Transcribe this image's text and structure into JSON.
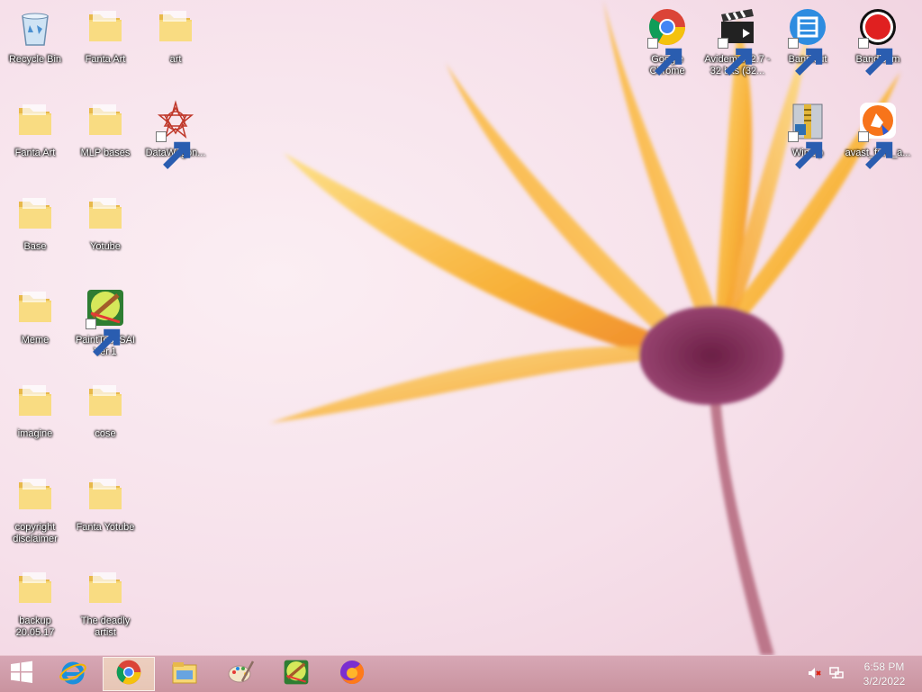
{
  "desktop": {
    "icons": [
      {
        "name": "recycle-bin",
        "label": "Recycle Bin",
        "icon": "recycle-bin-icon"
      },
      {
        "name": "folder-fanta-art-1",
        "label": "Fanta Art",
        "icon": "folder-icon"
      },
      {
        "name": "folder-art",
        "label": "art",
        "icon": "folder-icon"
      },
      {
        "name": "folder-fanta-art-2",
        "label": "Fanta Art",
        "icon": "folder-icon"
      },
      {
        "name": "folder-mlp-bases",
        "label": "MLP bases",
        "icon": "folder-icon"
      },
      {
        "name": "datawagon-shortcut",
        "label": "DataWagon...",
        "icon": "datawagon-icon"
      },
      {
        "name": "folder-base",
        "label": "Base",
        "icon": "folder-icon"
      },
      {
        "name": "folder-yotube",
        "label": "Yotube",
        "icon": "folder-icon"
      },
      {
        "name": "folder-meme",
        "label": "Meme",
        "icon": "folder-icon"
      },
      {
        "name": "painttool-sai-shortcut",
        "label": "PaintTool SAI Ver.1",
        "icon": "painttool-sai-icon"
      },
      {
        "name": "folder-imagine",
        "label": "imagine",
        "icon": "folder-icon"
      },
      {
        "name": "folder-cose",
        "label": "cose",
        "icon": "folder-icon"
      },
      {
        "name": "folder-copyright-disclaimer",
        "label": "copyright disclaimer",
        "icon": "folder-icon"
      },
      {
        "name": "folder-fanta-yotube",
        "label": "Fanta Yotube",
        "icon": "folder-icon"
      },
      {
        "name": "folder-backup",
        "label": "backup 20.05.17",
        "icon": "folder-icon"
      },
      {
        "name": "folder-the-deadly-artist",
        "label": "The deadly artist",
        "icon": "folder-icon"
      },
      {
        "name": "google-chrome-shortcut",
        "label": "Google Chrome",
        "icon": "chrome-icon"
      },
      {
        "name": "avidemux-shortcut",
        "label": "Avidemux 2.7 - 32 bits (32...",
        "icon": "avidemux-icon"
      },
      {
        "name": "bandicut-shortcut",
        "label": "Bandicut",
        "icon": "bandicut-icon"
      },
      {
        "name": "bandicam-shortcut",
        "label": "Bandicam",
        "icon": "bandicam-icon"
      },
      {
        "name": "winzip-shortcut",
        "label": "WinZip",
        "icon": "winzip-icon"
      },
      {
        "name": "avast-shortcut",
        "label": "avast_free_a...",
        "icon": "avast-icon"
      }
    ]
  },
  "taskbar": {
    "start": {
      "icon": "windows-start-icon"
    },
    "pinned": [
      {
        "name": "internet-explorer",
        "icon": "internet-explorer-icon",
        "active": false
      },
      {
        "name": "google-chrome",
        "icon": "chrome-icon",
        "active": true
      },
      {
        "name": "file-explorer",
        "icon": "file-explorer-icon",
        "active": false
      },
      {
        "name": "paint",
        "icon": "paint-palette-icon",
        "active": false
      },
      {
        "name": "painttool-sai",
        "icon": "painttool-sai-icon",
        "active": false
      },
      {
        "name": "firefox",
        "icon": "firefox-icon",
        "active": false
      }
    ],
    "tray": {
      "volume_icon": "speaker-muted-icon",
      "network_icon": "network-icon",
      "time": "6:58 PM",
      "date": "3/2/2022"
    }
  },
  "colors": {
    "wallpaper_bg": "#f6e0ea",
    "taskbar_bg": "#cf9aa7",
    "folder_yellow": "#f7d774",
    "petal_orange": "#f8a52b"
  }
}
